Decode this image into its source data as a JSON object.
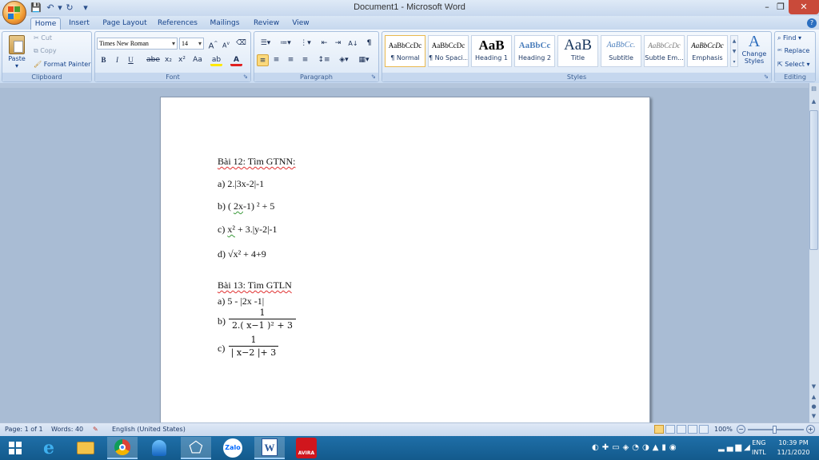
{
  "window": {
    "title": "Document1 - Microsoft Word",
    "minimize": "–",
    "restore": "❐",
    "close": "✕"
  },
  "qat": {
    "save_icon": "💾",
    "undo_icon": "↶",
    "redo_icon": "↻",
    "customize_icon": "▾"
  },
  "tabs": [
    {
      "label": "Home",
      "active": true
    },
    {
      "label": "Insert"
    },
    {
      "label": "Page Layout"
    },
    {
      "label": "References"
    },
    {
      "label": "Mailings"
    },
    {
      "label": "Review"
    },
    {
      "label": "View"
    }
  ],
  "help_icon": "?",
  "clipboard": {
    "group_label": "Clipboard",
    "paste": "Paste",
    "cut": "Cut",
    "copy": "Copy",
    "format_painter": "Format Painter"
  },
  "font": {
    "group_label": "Font",
    "name": "Times New Roman",
    "size": "14",
    "grow": "A",
    "shrink": "A",
    "clear": "⌫",
    "bold": "B",
    "italic": "I",
    "underline": "U",
    "strike": "abe",
    "subscript": "x₂",
    "superscript": "x²",
    "change_case": "Aa",
    "highlight": "ab",
    "font_color": "A"
  },
  "paragraph": {
    "group_label": "Paragraph",
    "show_marks": "¶",
    "sort": "A↓"
  },
  "styles": {
    "group_label": "Styles",
    "items": [
      {
        "preview": "AaBbCcDc",
        "name": "¶ Normal"
      },
      {
        "preview": "AaBbCcDc",
        "name": "¶ No Spaci..."
      },
      {
        "preview": "AaB",
        "name": "Heading 1"
      },
      {
        "preview": "AaBbCc",
        "name": "Heading 2"
      },
      {
        "preview": "AaB",
        "name": "Title"
      },
      {
        "preview": "AaBbCc.",
        "name": "Subtitle"
      },
      {
        "preview": "AaBbCcDc",
        "name": "Subtle Em..."
      },
      {
        "preview": "AaBbCcDc",
        "name": "Emphasis"
      }
    ],
    "change_styles": "Change Styles"
  },
  "editing": {
    "group_label": "Editing",
    "find": "Find",
    "replace": "Replace",
    "select": "Select"
  },
  "document": {
    "b12_title": "Bài 12: Tìm GTNN:",
    "b12_a": "a) 2.|3x-2|-1",
    "b12_b_prefix": "b) (",
    "b12_b_word": "2x",
    "b12_b_rest": "-1) ² + 5",
    "b12_c_prefix": "c) ",
    "b12_c_word": "x²",
    "b12_c_rest": " + 3.|y-2|-1",
    "b12_d": "d) √x² + 4+9",
    "b13_title": "Bài 13: Tìm GTLN",
    "b13_a": "a) 5 - |2x -1|",
    "b13_b_label": "b)",
    "b13_b_num": "1",
    "b13_b_den": "2.( x−1 )² + 3",
    "b13_c_label": "c)",
    "b13_c_num": "1",
    "b13_c_den": "| x−2 |+ 3"
  },
  "status": {
    "page": "Page: 1 of 1",
    "words": "Words: 40",
    "language": "English (United States)",
    "zoom": "100%",
    "zoom_minus": "−",
    "zoom_plus": "+"
  },
  "taskbar": {
    "language_top": "ENG",
    "language_bottom": "INTL",
    "time": "10:39 PM",
    "date": "11/1/2020",
    "zalo_label": "Zalo",
    "avira_label": "AVIRA"
  }
}
